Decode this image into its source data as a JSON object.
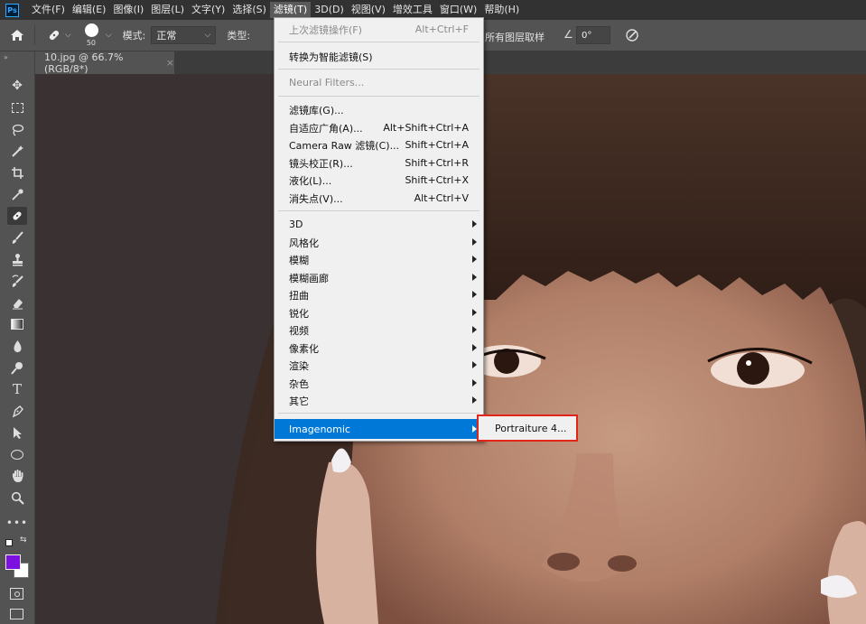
{
  "app": {
    "logo": "Ps"
  },
  "menubar": {
    "items": [
      "文件(F)",
      "编辑(E)",
      "图像(I)",
      "图层(L)",
      "文字(Y)",
      "选择(S)",
      "滤镜(T)",
      "3D(D)",
      "视图(V)",
      "增效工具",
      "窗口(W)",
      "帮助(H)"
    ],
    "active_index": 6
  },
  "options": {
    "brush_size": "50",
    "mode_label": "模式:",
    "mode_value": "正常",
    "type_label": "类型:",
    "sample_all_layers": "所有图层取样",
    "angle": "0°"
  },
  "document": {
    "tab_title": "10.jpg @ 66.7%(RGB/8*)",
    "close": "×"
  },
  "filter_menu": {
    "items": [
      {
        "label": "上次滤镜操作(F)",
        "shortcut": "Alt+Ctrl+F",
        "disabled": true
      },
      {
        "label": "转换为智能滤镜(S)",
        "shortcut": ""
      },
      {
        "label": "Neural Filters...",
        "shortcut": "",
        "disabled": true
      },
      {
        "label": "滤镜库(G)...",
        "shortcut": ""
      },
      {
        "label": "自适应广角(A)...",
        "shortcut": "Alt+Shift+Ctrl+A"
      },
      {
        "label": "Camera Raw 滤镜(C)...",
        "shortcut": "Shift+Ctrl+A"
      },
      {
        "label": "镜头校正(R)...",
        "shortcut": "Shift+Ctrl+R"
      },
      {
        "label": "液化(L)...",
        "shortcut": "Shift+Ctrl+X"
      },
      {
        "label": "消失点(V)...",
        "shortcut": "Alt+Ctrl+V"
      },
      {
        "label": "3D",
        "submenu": true
      },
      {
        "label": "风格化",
        "submenu": true
      },
      {
        "label": "模糊",
        "submenu": true
      },
      {
        "label": "模糊画廊",
        "submenu": true
      },
      {
        "label": "扭曲",
        "submenu": true
      },
      {
        "label": "锐化",
        "submenu": true
      },
      {
        "label": "视频",
        "submenu": true
      },
      {
        "label": "像素化",
        "submenu": true
      },
      {
        "label": "渲染",
        "submenu": true
      },
      {
        "label": "杂色",
        "submenu": true
      },
      {
        "label": "其它",
        "submenu": true
      },
      {
        "label": "Imagenomic",
        "submenu": true,
        "highlighted": true
      }
    ]
  },
  "imagenomic_submenu": {
    "items": [
      "Portraiture 4..."
    ],
    "highlight_color": "#e1251b"
  },
  "colors": {
    "foreground": "#7b10e0",
    "background": "#ffffff",
    "menu_highlight": "#0078d7"
  }
}
